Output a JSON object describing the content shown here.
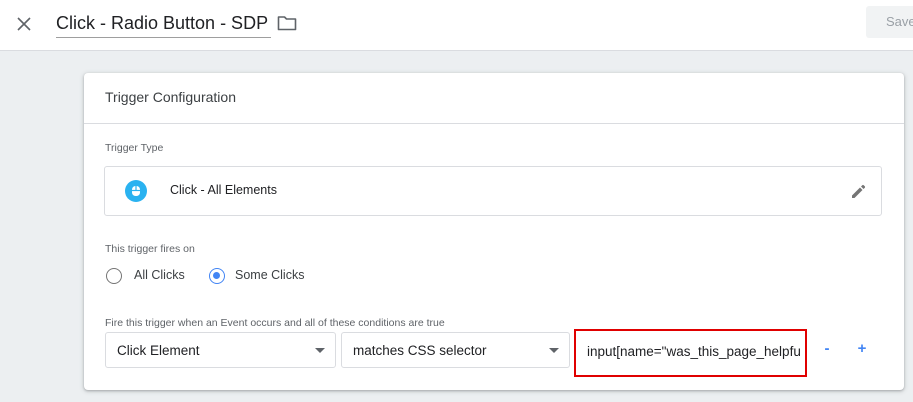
{
  "header": {
    "title": "Click - Radio Button - SDP",
    "save_label": "Save",
    "close_icon": "close-icon",
    "folder_icon": "folder-icon"
  },
  "card": {
    "title": "Trigger Configuration",
    "trigger_type_label": "Trigger Type",
    "trigger_type": {
      "name": "Click - All Elements",
      "icon": "click-icon",
      "icon_color": "#2ab2f0",
      "edit_icon": "edit-pencil-icon"
    },
    "fires_on_label": "This trigger fires on",
    "fires_on_options": [
      {
        "label": "All Clicks",
        "selected": false
      },
      {
        "label": "Some Clicks",
        "selected": true
      }
    ],
    "condition_label": "Fire this trigger when an Event occurs and all of these conditions are true",
    "condition": {
      "variable": "Click Element",
      "operator": "matches CSS selector",
      "value": "input[name=\"was_this_page_helpfu",
      "remove_label": "-",
      "add_label": "+"
    }
  },
  "colors": {
    "accent": "#4285f4",
    "highlight": "#e00000",
    "background": "#eceff1"
  }
}
